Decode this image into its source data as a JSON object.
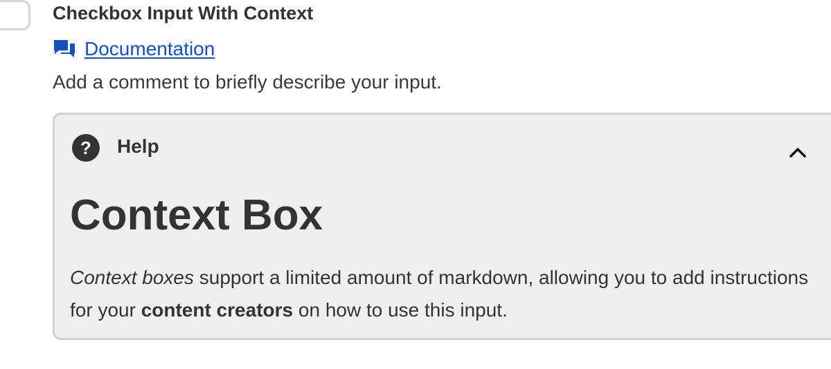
{
  "field": {
    "title": "Checkbox Input With Context",
    "checked": false,
    "documentation_link": "Documentation",
    "description": "Add a comment to briefly describe your input."
  },
  "icons": {
    "documentation": "chat-bubbles-icon",
    "help": "question-circle-icon",
    "collapse": "chevron-up-icon"
  },
  "context_box": {
    "toggle_label": "Help",
    "expanded": true,
    "heading": "Context Box",
    "body": {
      "part1_italic": "Context boxes",
      "part2": " support a limited amount of markdown, allowing you to add instructions for your ",
      "part3_bold": "content creators",
      "part4": " on how to use this input."
    }
  },
  "colors": {
    "link": "#1650c0",
    "text": "#333333",
    "box_background": "#efefef",
    "box_border": "#d1d1d1"
  }
}
